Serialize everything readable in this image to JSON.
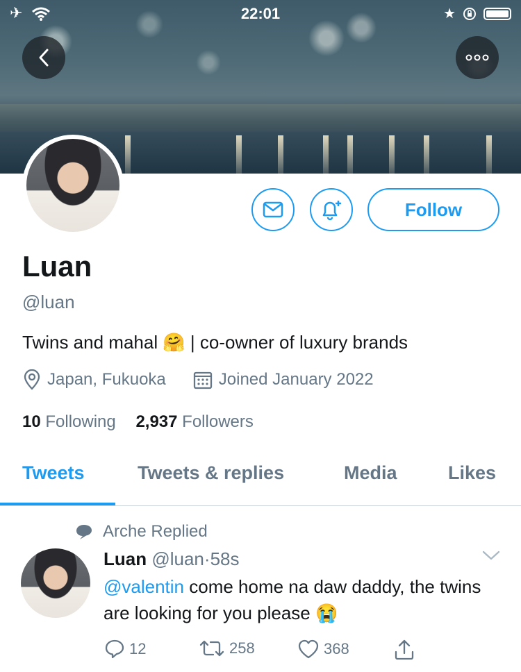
{
  "status_bar": {
    "time": "22:01",
    "left_icons": [
      "airplane-icon",
      "wifi-icon"
    ],
    "right_icons": [
      "star-icon",
      "rotation-lock-icon",
      "battery-icon"
    ]
  },
  "header": {
    "back_icon": "chevron-left-icon",
    "more_icon": "more-icon"
  },
  "profile": {
    "name": "Luan",
    "handle": "@luan",
    "bio_before": "Twins and mahal ",
    "bio_emoji": "🤗",
    "bio_after": " | co-owner of luxury brands",
    "location": "Japan, Fukuoka",
    "joined": "Joined January 2022",
    "following_count": "10",
    "following_label": "Following",
    "followers_count": "2,937",
    "followers_label": "Followers",
    "follow_label": "Follow"
  },
  "tabs": [
    {
      "label": "Tweets",
      "active": true
    },
    {
      "label": "Tweets & replies",
      "active": false
    },
    {
      "label": "Media",
      "active": false
    },
    {
      "label": "Likes",
      "active": false
    }
  ],
  "tweet": {
    "context": "Arche Replied",
    "author_name": "Luan",
    "author_handle": "@luan",
    "separator": "·",
    "time": "58s",
    "mention": "@valentin",
    "text": " come home na daw daddy, the twins are looking for you please ",
    "emoji": "😭",
    "replies": "12",
    "retweets": "258",
    "likes": "368"
  },
  "colors": {
    "accent": "#1d9bf0",
    "secondary_text": "#657786",
    "primary_text": "#14171a"
  }
}
